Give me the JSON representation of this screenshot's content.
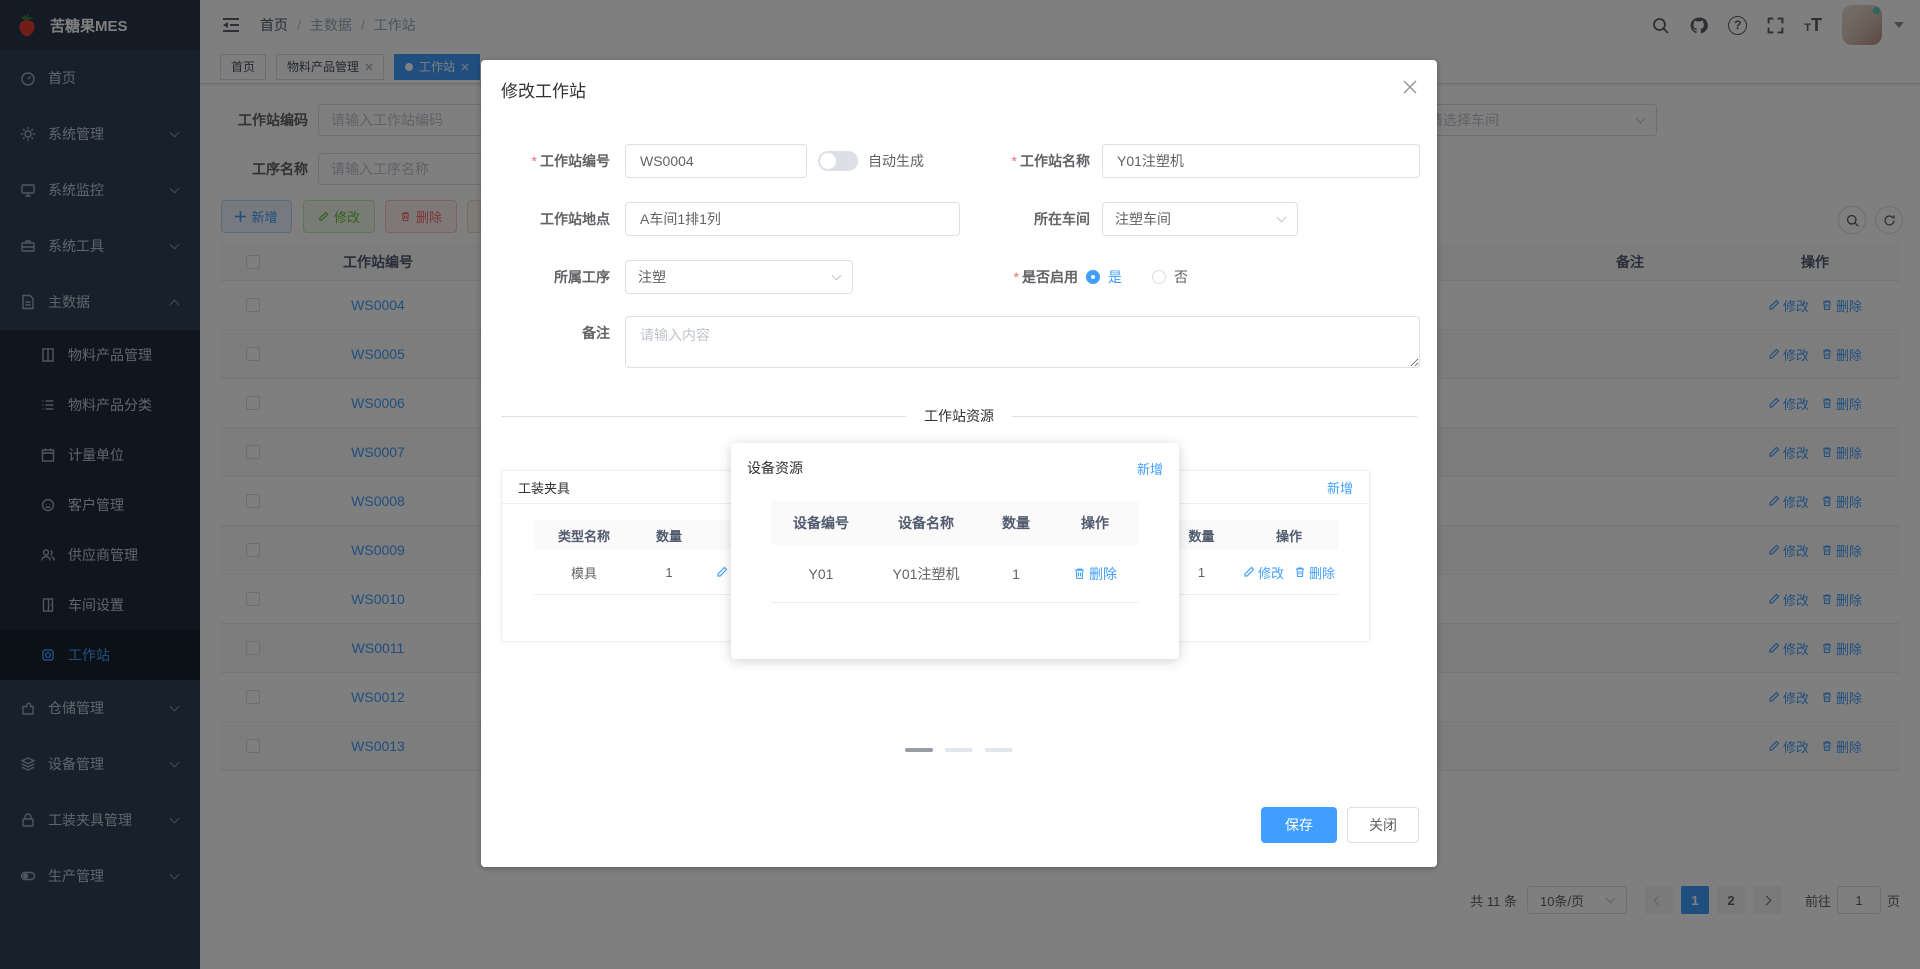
{
  "colors": {
    "primary": "#409eff",
    "sidebar_bg": "#304156",
    "submenu_bg": "#1f2d3d",
    "success": "#67c23a",
    "danger": "#f56c6c",
    "warning": "#e6a23c"
  },
  "app": {
    "title": "苦糖果MES"
  },
  "navbar": {
    "breadcrumb": [
      "首页",
      "主数据",
      "工作站"
    ],
    "help_glyph": "?",
    "font_glyph_small": "T",
    "font_glyph_large": "T"
  },
  "tabs": [
    {
      "label": "首页"
    },
    {
      "label": "物料产品管理"
    },
    {
      "label": "工作站"
    }
  ],
  "sidebar": {
    "top": [
      "首页",
      "系统管理",
      "系统监控",
      "系统工具",
      "主数据"
    ],
    "sub": [
      "物料产品管理",
      "物料产品分类",
      "计量单位",
      "客户管理",
      "供应商管理",
      "车间设置",
      "工作站"
    ],
    "bottom": [
      "仓储管理",
      "设备管理",
      "工装夹具管理",
      "生产管理"
    ]
  },
  "filters": {
    "station_code_label": "工作站编码",
    "station_code_placeholder": "请输入工作站编码",
    "process_name_label": "工序名称",
    "process_name_placeholder": "请输入工序名称",
    "workshop_placeholder": "请选择车间"
  },
  "toolbar": {
    "add": "新增",
    "edit": "修改",
    "remove": "删除"
  },
  "table": {
    "col_code": "工作站编号",
    "col_remark": "备注",
    "col_action": "操作",
    "edit": "修改",
    "remove": "删除",
    "rows": [
      "WS0004",
      "WS0005",
      "WS0006",
      "WS0007",
      "WS0008",
      "WS0009",
      "WS0010",
      "WS0011",
      "WS0012",
      "WS0013"
    ]
  },
  "pagination": {
    "total": "共 11 条",
    "page_size": "10条/页",
    "page1": "1",
    "page2": "2",
    "goto_label": "前往",
    "goto_value": "1",
    "page_unit": "页"
  },
  "dialog": {
    "title": "修改工作站",
    "code_label": "工作站编号",
    "code_value": "WS0004",
    "auto_label": "自动生成",
    "name_label": "工作站名称",
    "name_value": "Y01注塑机",
    "location_label": "工作站地点",
    "location_value": "A车间1排1列",
    "workshop_label": "所在车间",
    "workshop_value": "注塑车间",
    "process_label": "所属工序",
    "process_value": "注塑",
    "enable_label": "是否启用",
    "enable_yes": "是",
    "enable_no": "否",
    "remark_label": "备注",
    "remark_placeholder": "请输入内容",
    "section_title": "工作站资源",
    "fixture_card": {
      "title": "工装夹具",
      "col_type": "类型名称",
      "col_qty": "数量",
      "col_action": "操作",
      "row": {
        "type": "模具",
        "qty": "1"
      },
      "edit": "修改"
    },
    "device_card": {
      "title": "设备资源",
      "add": "新增",
      "col_code": "设备编号",
      "col_name": "设备名称",
      "col_qty": "数量",
      "col_action": "操作",
      "row": {
        "code": "Y01",
        "name": "Y01注塑机",
        "qty": "1"
      },
      "remove": "删除"
    },
    "side_card": {
      "add": "新增",
      "col_qty": "数量",
      "col_action": "操作",
      "row": {
        "qty": "1"
      },
      "edit": "修改",
      "remove": "删除"
    },
    "save": "保存",
    "close": "关闭"
  }
}
